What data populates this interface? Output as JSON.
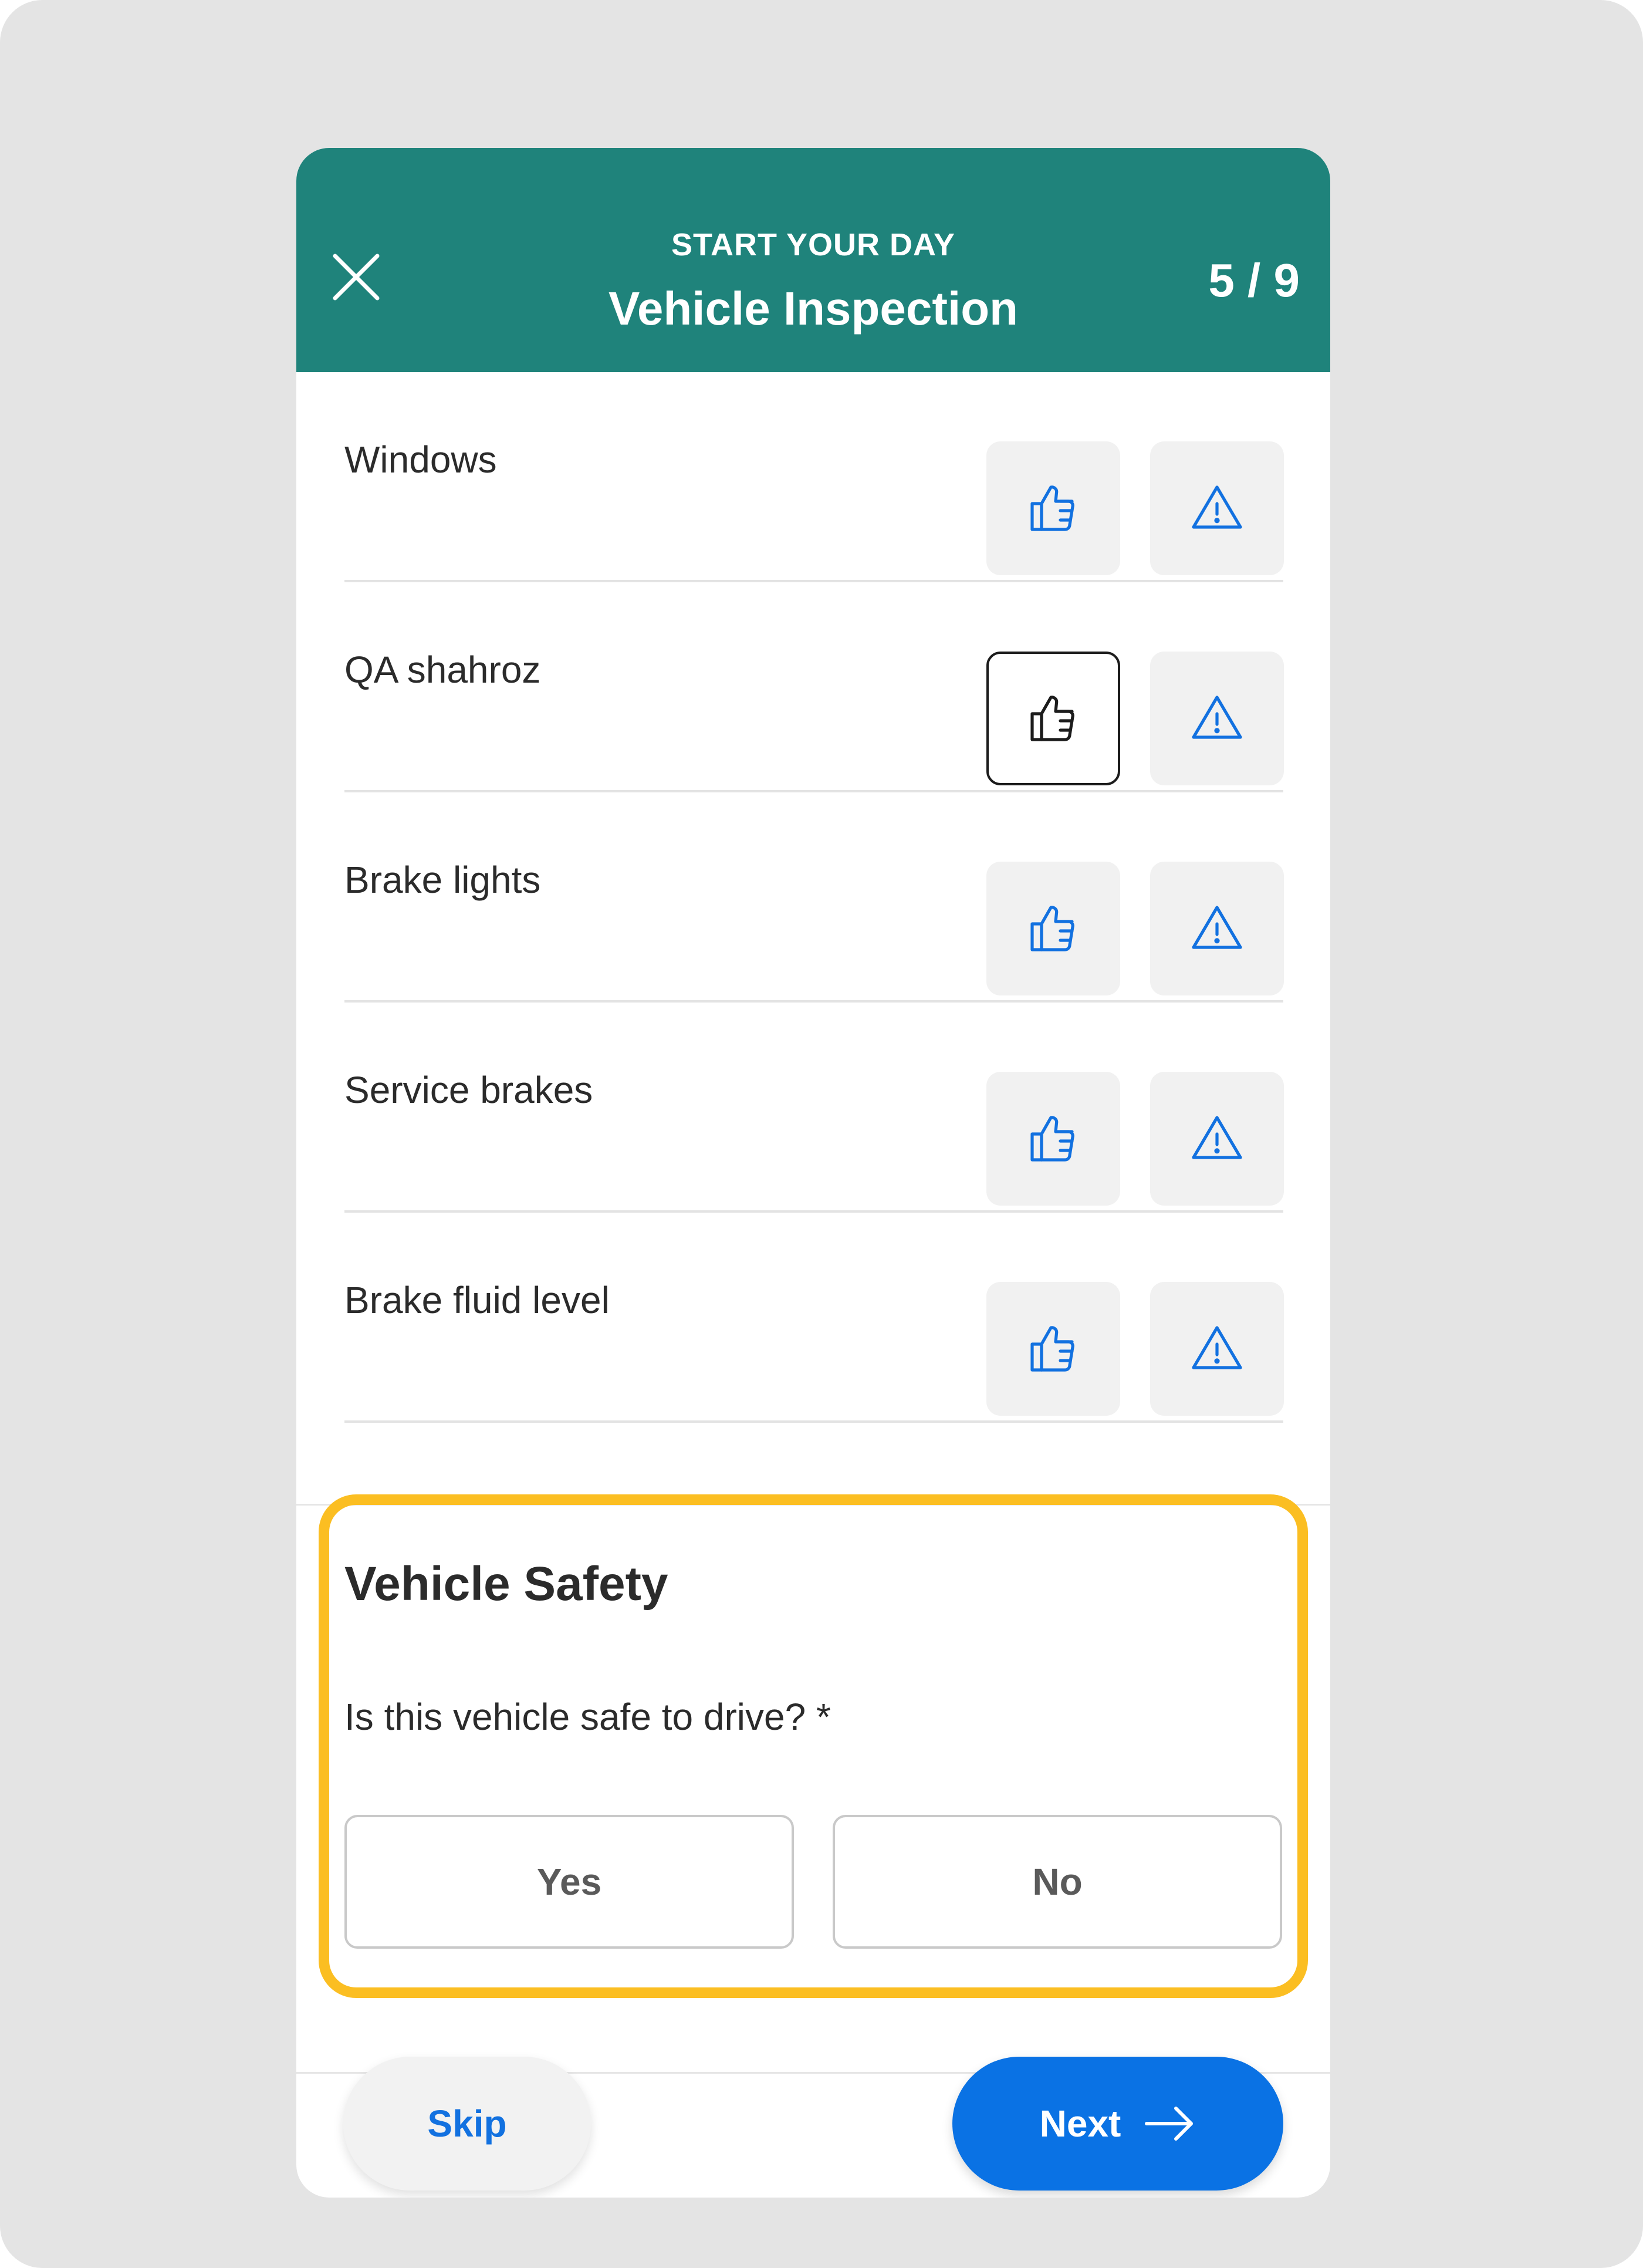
{
  "header": {
    "eyebrow": "START YOUR DAY",
    "title": "Vehicle Inspection",
    "step": "5 / 9",
    "close_icon": "close-icon",
    "color": "#1f837b"
  },
  "inspection_items": [
    {
      "label": "Windows",
      "status": "none"
    },
    {
      "label": "QA shahroz",
      "status": "ok"
    },
    {
      "label": "Brake lights",
      "status": "none"
    },
    {
      "label": "Service brakes",
      "status": "none"
    },
    {
      "label": "Brake fluid level",
      "status": "none"
    }
  ],
  "item_icons": {
    "ok": "thumbs-up-icon",
    "issue": "warning-triangle-icon",
    "icon_color": "#1271e0"
  },
  "safety": {
    "title": "Vehicle Safety",
    "question": "Is this vehicle safe to drive? *",
    "yes_label": "Yes",
    "no_label": "No",
    "highlight_color": "#fbbe22"
  },
  "footer": {
    "skip_label": "Skip",
    "next_label": "Next",
    "next_icon": "arrow-right-icon",
    "accent": "#0a72e4"
  }
}
